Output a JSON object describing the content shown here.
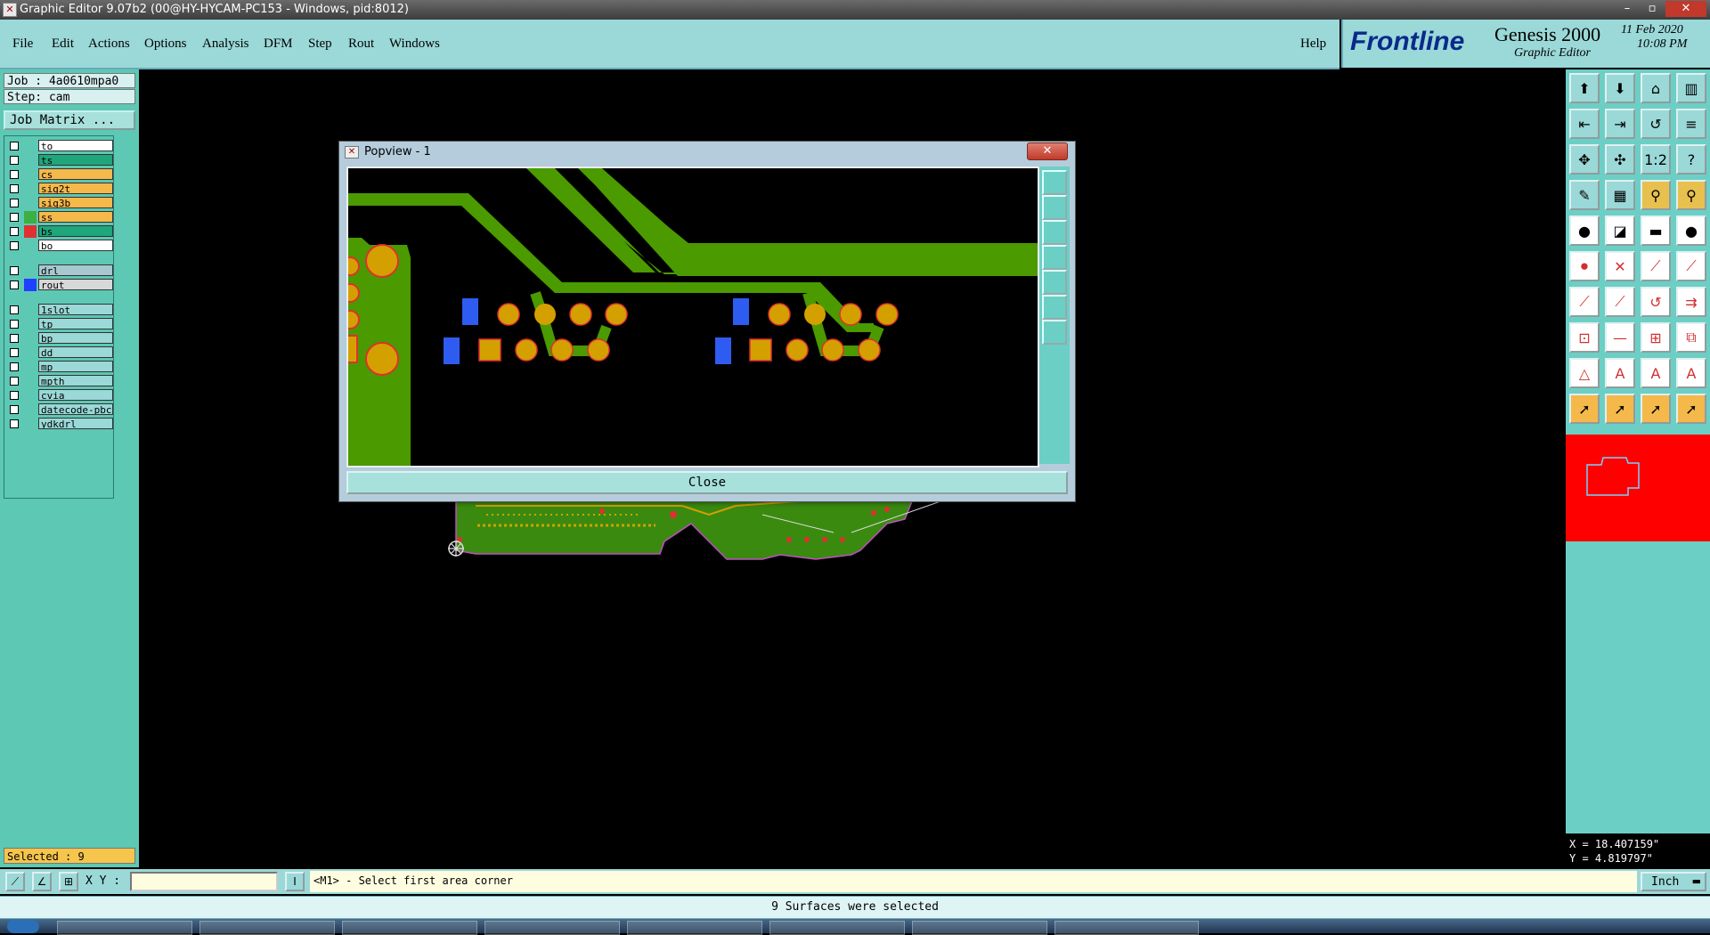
{
  "window": {
    "title": "Graphic Editor 9.07b2 (00@HY-HYCAM-PC153 - Windows, pid:8012)"
  },
  "menu": [
    "File",
    "Edit",
    "Actions",
    "Options",
    "Analysis",
    "DFM",
    "Step",
    "Rout",
    "Windows"
  ],
  "help": "Help",
  "brand": {
    "logo": "Frontline",
    "product": "Genesis 2000",
    "subtitle": "Graphic Editor",
    "date": "11 Feb 2020",
    "time": "10:08 PM"
  },
  "job": {
    "job": "Job : 4a0610mpa0",
    "step": "Step: cam",
    "matrix": "Job Matrix ..."
  },
  "layers": [
    {
      "name": "to",
      "color": "#ffffff",
      "swatch": ""
    },
    {
      "name": "ts",
      "color": "#1fa67a",
      "swatch": ""
    },
    {
      "name": "cs",
      "color": "#f5b84a",
      "swatch": ""
    },
    {
      "name": "sig2t",
      "color": "#f5b84a",
      "swatch": ""
    },
    {
      "name": "sig3b",
      "color": "#f5b84a",
      "swatch": ""
    },
    {
      "name": "ss",
      "color": "#f5b84a",
      "swatch": "#3cb043"
    },
    {
      "name": "bs",
      "color": "#1fa67a",
      "swatch": "#e03030"
    },
    {
      "name": "bo",
      "color": "#ffffff",
      "swatch": ""
    },
    {
      "name": "drl",
      "color": "#a8c8d0",
      "swatch": ""
    },
    {
      "name": "rout",
      "color": "#d8d8d8",
      "swatch": "#2040ff"
    },
    {
      "name": "1slot",
      "color": "#9bd8d8",
      "swatch": ""
    },
    {
      "name": "tp",
      "color": "#9bd8d8",
      "swatch": ""
    },
    {
      "name": "bp",
      "color": "#9bd8d8",
      "swatch": ""
    },
    {
      "name": "dd",
      "color": "#9bd8d8",
      "swatch": ""
    },
    {
      "name": "mp",
      "color": "#9bd8d8",
      "swatch": ""
    },
    {
      "name": "mpth",
      "color": "#9bd8d8",
      "swatch": ""
    },
    {
      "name": "cvia",
      "color": "#9bd8d8",
      "swatch": ""
    },
    {
      "name": "datecode-pbc",
      "color": "#9bd8d8",
      "swatch": ""
    },
    {
      "name": "ydkdrl",
      "color": "#9bd8d8",
      "swatch": ""
    }
  ],
  "selected": "Selected : 9",
  "popup": {
    "title": "Popview - 1",
    "close_x": "✕",
    "close": "Close"
  },
  "status": {
    "xy_label": "X Y :",
    "xy_value": "",
    "prompt": "<M1> - Select first area corner",
    "units": "Inch"
  },
  "info": "9 Surfaces were selected",
  "coords": {
    "x": "X = 18.407159\"",
    "y": "Y = 4.819797\""
  },
  "colors": {
    "panel": "#9bd8d8",
    "layerpanel": "#5dc8b4",
    "copper": "#4a9a00",
    "pad": "#d4a000",
    "blue": "#2f5cf0"
  }
}
